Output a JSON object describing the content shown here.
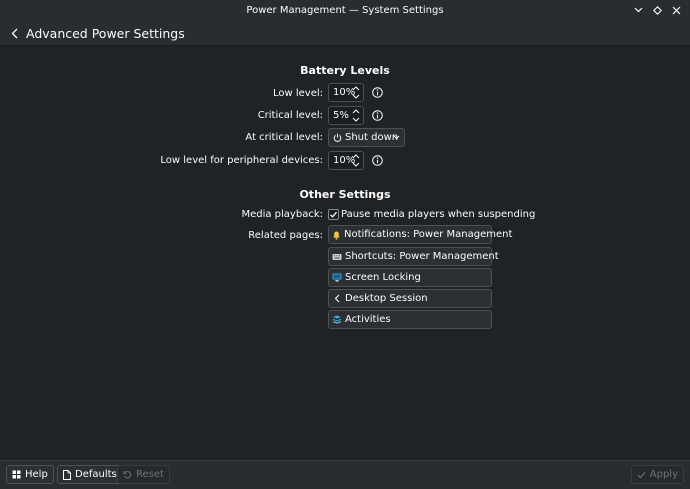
{
  "window": {
    "title": "Power Management — System Settings"
  },
  "header": {
    "title": "Advanced Power Settings"
  },
  "battery": {
    "section_title": "Battery Levels",
    "low_label": "Low level:",
    "low_value": "10%",
    "critical_label": "Critical level:",
    "critical_value": "5%",
    "at_critical_label": "At critical level:",
    "at_critical_value": "Shut down",
    "peripheral_label": "Low level for peripheral devices:",
    "peripheral_value": "10%"
  },
  "other": {
    "section_title": "Other Settings",
    "media_label": "Media playback:",
    "media_checkbox_label": "Pause media players when suspending",
    "media_checked": true,
    "related_label": "Related pages:",
    "related_pages": [
      {
        "label": "Notifications: Power Management",
        "icon": "bell-icon"
      },
      {
        "label": "Shortcuts: Power Management",
        "icon": "keyboard-icon"
      },
      {
        "label": "Screen Locking",
        "icon": "monitor-icon"
      },
      {
        "label": "Desktop Session",
        "icon": "chevron-left-icon"
      },
      {
        "label": "Activities",
        "icon": "activities-icon"
      }
    ]
  },
  "footer": {
    "help": "Help",
    "defaults": "Defaults",
    "reset": "Reset",
    "apply": "Apply"
  },
  "colors": {
    "background": "#202326",
    "header": "#292c30",
    "accent": "#3daee9"
  }
}
